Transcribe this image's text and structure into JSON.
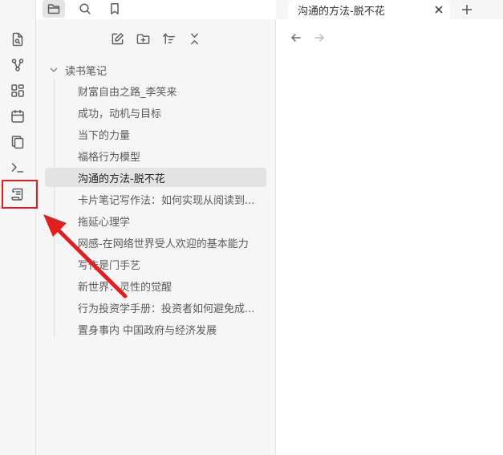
{
  "colors": {
    "annotation": "#e02020",
    "active_bg": "#e3e3e3"
  },
  "topbar": {
    "icons": [
      "sidebar-toggle-icon",
      "folder-icon",
      "search-icon",
      "bookmark-icon"
    ]
  },
  "ribbon": {
    "icons": [
      "file-search-icon",
      "graph-icon",
      "grid-icon",
      "calendar-icon",
      "copy-icon",
      "terminal-icon",
      "scroll-icon"
    ]
  },
  "sidebar": {
    "nav_icons": [
      "new-note-icon",
      "new-folder-icon",
      "sort-icon",
      "collapse-icon"
    ],
    "folder": {
      "name": "读书笔记"
    },
    "files": [
      {
        "name": "财富自由之路_李笑来"
      },
      {
        "name": "成功，动机与目标"
      },
      {
        "name": "当下的力量"
      },
      {
        "name": "福格行为模型"
      },
      {
        "name": "沟通的方法-脱不花"
      },
      {
        "name": "卡片笔记写作法：如何实现从阅读到..."
      },
      {
        "name": "拖延心理学"
      },
      {
        "name": "网感-在网络世界受人欢迎的基本能力"
      },
      {
        "name": "写作是门手艺"
      },
      {
        "name": "新世界：灵性的觉醒"
      },
      {
        "name": "行为投资学手册：投资者如何避免成..."
      },
      {
        "name": "置身事内 中国政府与经济发展"
      }
    ],
    "active_index": 4
  },
  "tabs": [
    {
      "title": "沟通的方法-脱不花"
    }
  ]
}
